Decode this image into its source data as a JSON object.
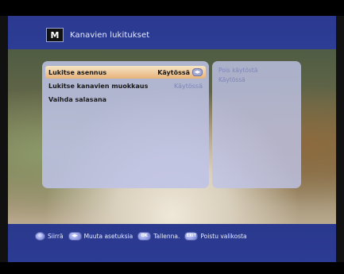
{
  "title": {
    "icon_name": "lock-icon",
    "icon_glyph": "M",
    "text": "Kanavien lukitukset"
  },
  "menu": {
    "items": [
      {
        "label": "Lukitse asennus",
        "value": "Käytössä",
        "selected": true,
        "has_lr_icon": true
      },
      {
        "label": "Lukitse kanavien muokkaus",
        "value": "Käytössä",
        "selected": false,
        "has_lr_icon": false
      },
      {
        "label": "Vaihda salasana",
        "value": "",
        "selected": false,
        "has_lr_icon": false
      }
    ]
  },
  "options": {
    "items": [
      "Pois käytöstä",
      "Käytössä"
    ]
  },
  "help": {
    "items": [
      {
        "button": "◎",
        "label": "Siirrä"
      },
      {
        "button": "◀▶",
        "label": "Muuta asetuksia"
      },
      {
        "button": "OK",
        "label": "Tallenna."
      },
      {
        "button": "EXIT",
        "label": "Poistu valikosta"
      }
    ]
  }
}
